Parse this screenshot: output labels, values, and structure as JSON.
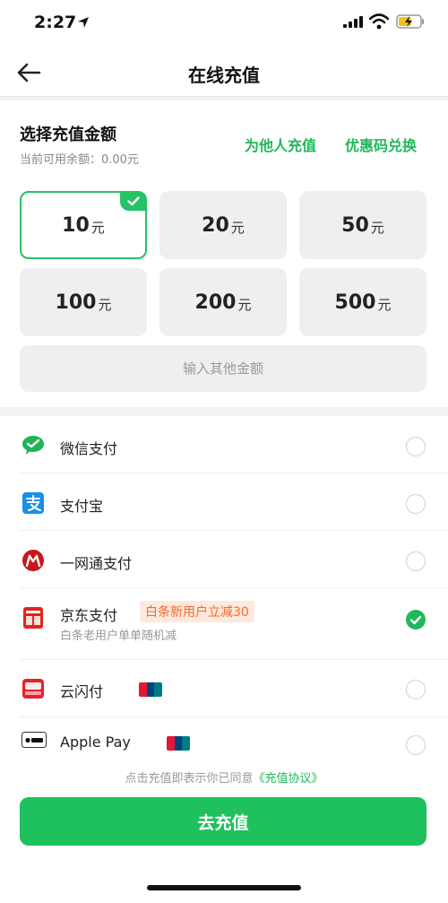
{
  "status": {
    "time": "2:27"
  },
  "nav": {
    "title": "在线充值"
  },
  "amount_section": {
    "title": "选择充值金额",
    "balance": "当前可用余额：0.00元",
    "link_other": "为他人充值",
    "link_coupon": "优惠码兑换",
    "options": [
      {
        "value": "10",
        "unit": "元",
        "selected": true
      },
      {
        "value": "20",
        "unit": "元",
        "selected": false
      },
      {
        "value": "50",
        "unit": "元",
        "selected": false
      },
      {
        "value": "100",
        "unit": "元",
        "selected": false
      },
      {
        "value": "200",
        "unit": "元",
        "selected": false
      },
      {
        "value": "500",
        "unit": "元",
        "selected": false
      }
    ],
    "custom_placeholder": "输入其他金额"
  },
  "payment_methods": [
    {
      "label": "微信支付",
      "icon": "wechat-pay-icon",
      "selected": false
    },
    {
      "label": "支付宝",
      "icon": "alipay-icon",
      "selected": false
    },
    {
      "label": "一网通支付",
      "icon": "cmb-icon",
      "selected": false
    },
    {
      "label": "京东支付",
      "icon": "jd-pay-icon",
      "selected": true,
      "badge": "白条新用户立减30",
      "subtitle": "白条老用户单单随机减"
    },
    {
      "label": "云闪付",
      "icon": "cloud-quickpass-icon",
      "selected": false
    },
    {
      "label": "Apple Pay",
      "icon": "apple-pay-icon",
      "selected": false
    }
  ],
  "agreement": {
    "prefix": "点击充值即表示你已同意",
    "link": "《充值协议》"
  },
  "submit": {
    "label": "去充值"
  },
  "colors": {
    "accent": "#1fc05e",
    "promo": "#f06a2a"
  }
}
